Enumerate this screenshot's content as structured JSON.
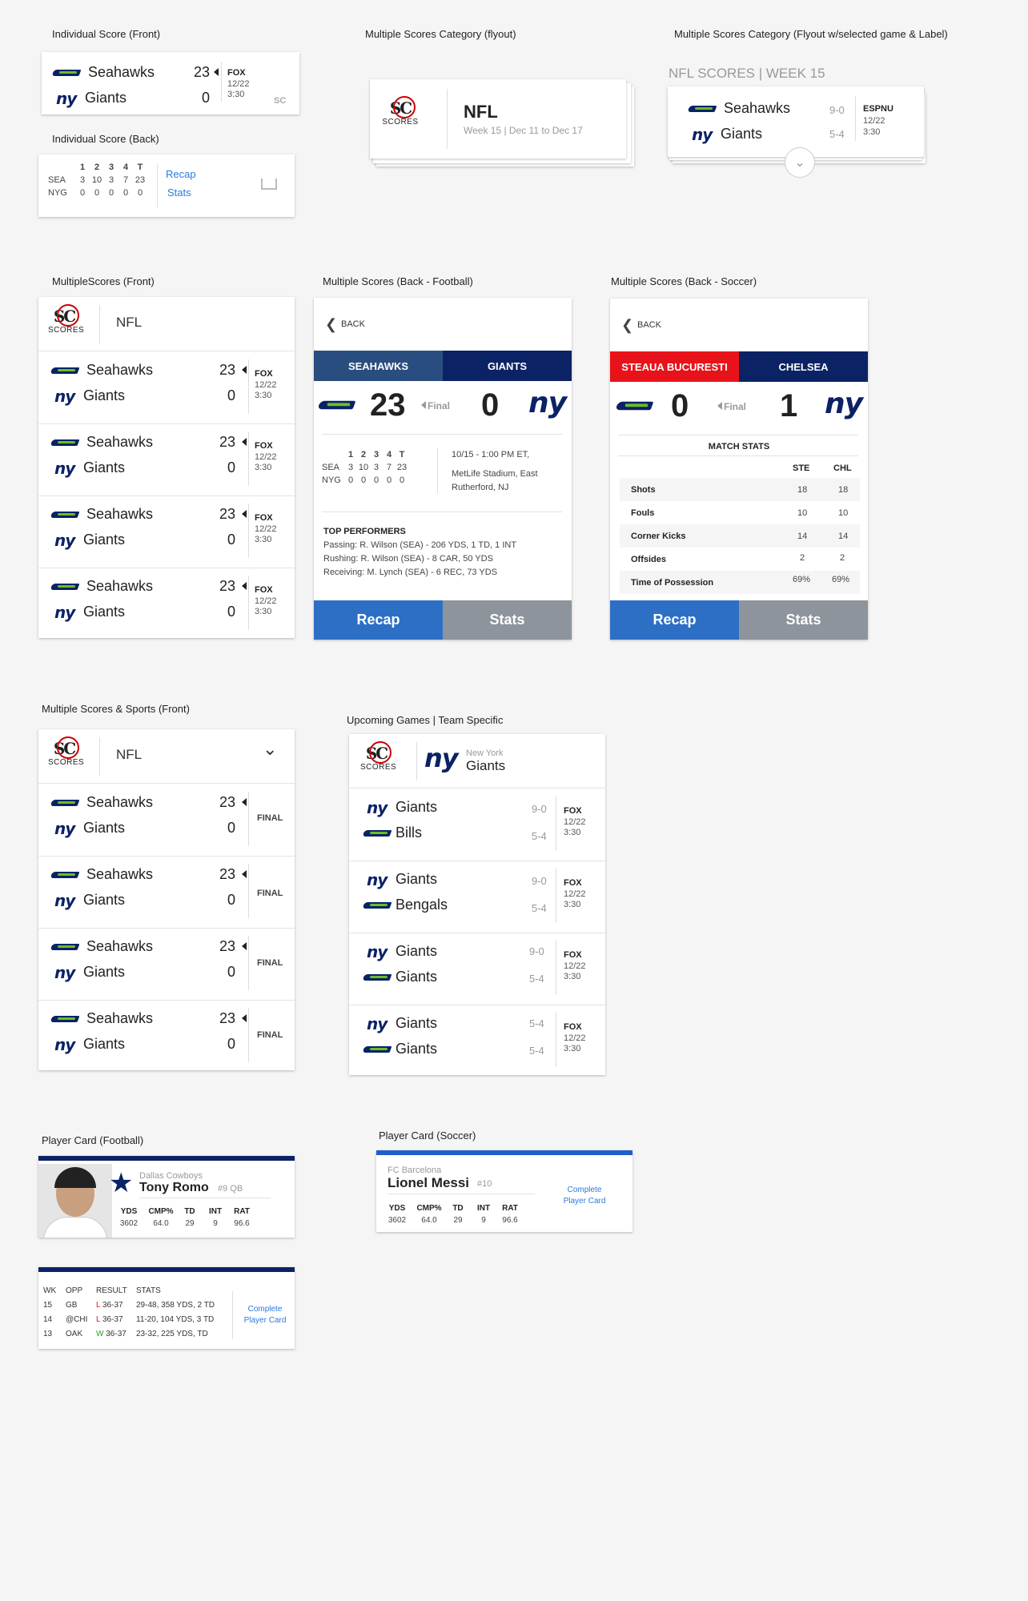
{
  "titles": {
    "ind_front": "Individual Score (Front)",
    "ind_back": "Individual Score (Back)",
    "multi_flyout": "Multiple Scores Category (flyout)",
    "multi_flyout_sel": "Multiple Scores Category (Flyout w/selected game & Label)",
    "multi_front": "MultipleScores (Front)",
    "multi_back_fb": "Multiple Scores (Back - Football)",
    "multi_back_soc": "Multiple Scores (Back - Soccer)",
    "multi_sports": "Multiple Scores & Sports (Front)",
    "upcoming": "Upcoming Games | Team Specific",
    "player_fb": "Player Card (Football)",
    "player_soc": "Player Card (Soccer)"
  },
  "sc_label": "SCORES",
  "teams": {
    "sea": "Seahawks",
    "nyg": "Giants",
    "bills": "Bills",
    "bengals": "Bengals"
  },
  "game": {
    "sea_score": "23",
    "nyg_score": "0",
    "network": "FOX",
    "date": "12/22",
    "time": "3:30",
    "final": "FINAL"
  },
  "ind_back": {
    "head": [
      "1",
      "2",
      "3",
      "4",
      "T"
    ],
    "sea": [
      "SEA",
      "3",
      "10",
      "3",
      "7",
      "23"
    ],
    "nyg": [
      "NYG",
      "0",
      "0",
      "0",
      "0",
      "0"
    ],
    "recap": "Recap",
    "stats": "Stats"
  },
  "flyout": {
    "league": "NFL",
    "week": "Week 15 | Dec 11 to Dec 17"
  },
  "flyout_sel": {
    "label": "NFL SCORES | WEEK 15",
    "rec1": "9-0",
    "rec2": "5-4",
    "network": "ESPNU"
  },
  "multi": {
    "league": "NFL"
  },
  "back_fb": {
    "back": "BACK",
    "team1": "SEAHAWKS",
    "team2": "GIANTS",
    "s1": "23",
    "s2": "0",
    "final": "Final",
    "when": "10/15 - 1:00 PM ET,",
    "venue1": "MetLife Stadium, East",
    "venue2": "Rutherford, NJ",
    "perf_title": "TOP PERFORMERS",
    "perf": [
      "Passing: R. Wilson (SEA) - 206 YDS, 1 TD, 1 INT",
      "Rushing: R. Wilson (SEA) - 8 CAR, 50 YDS",
      "Receiving: M. Lynch (SEA) - 6 REC, 73 YDS"
    ],
    "recap": "Recap",
    "stats": "Stats"
  },
  "back_soc": {
    "back": "BACK",
    "team1": "STEAUA BUCURESTI",
    "team2": "CHELSEA",
    "s1": "0",
    "s2": "1",
    "final": "Final",
    "stats_title": "MATCH STATS",
    "c1": "STE",
    "c2": "CHL",
    "rows": [
      [
        "Shots",
        "18",
        "18"
      ],
      [
        "Fouls",
        "10",
        "10"
      ],
      [
        "Corner Kicks",
        "14",
        "14"
      ],
      [
        "Offsides",
        "2",
        "2"
      ],
      [
        "Time of Possession",
        "69%",
        "69%"
      ]
    ],
    "recap": "Recap",
    "stats": "Stats"
  },
  "upcoming": {
    "city": "New York",
    "team": "Giants",
    "games": [
      {
        "t1": "Giants",
        "t2": "Bills",
        "r1": "9-0",
        "r2": "5-4"
      },
      {
        "t1": "Giants",
        "t2": "Bengals",
        "r1": "9-0",
        "r2": "5-4"
      },
      {
        "t1": "Giants",
        "t2": "Giants",
        "r1": "9-0",
        "r2": "5-4"
      },
      {
        "t1": "Giants",
        "t2": "Giants",
        "r1": "5-4",
        "r2": "5-4"
      }
    ]
  },
  "player_fb": {
    "team": "Dallas Cowboys",
    "name": "Tony Romo",
    "num": "#9 QB",
    "stat_heads": [
      "YDS",
      "CMP%",
      "TD",
      "INT",
      "RAT"
    ],
    "stat_vals": [
      "3602",
      "64.0",
      "29",
      "9",
      "96.6"
    ],
    "log_heads": [
      "WK",
      "OPP",
      "RESULT",
      "STATS"
    ],
    "log": [
      [
        "15",
        "GB",
        "L",
        "36-37",
        "29-48, 358 YDS, 2 TD"
      ],
      [
        "14",
        "@CHI",
        "L",
        "36-37",
        "11-20, 104 YDS, 3 TD"
      ],
      [
        "13",
        "OAK",
        "W",
        "36-37",
        "23-32, 225 YDS, TD"
      ]
    ],
    "complete1": "Complete",
    "complete2": "Player Card"
  },
  "player_soc": {
    "team": "FC Barcelona",
    "name": "Lionel Messi",
    "num": "#10",
    "stat_heads": [
      "YDS",
      "CMP%",
      "TD",
      "INT",
      "RAT"
    ],
    "stat_vals": [
      "3602",
      "64.0",
      "29",
      "9",
      "96.6"
    ],
    "complete1": "Complete",
    "complete2": "Player Card"
  },
  "colors": {
    "navy": "#0b2265",
    "blue_btn": "#2e6fc6",
    "gray_btn": "#8e949c",
    "red": "#e8131a",
    "sea_green": "#69be28"
  }
}
